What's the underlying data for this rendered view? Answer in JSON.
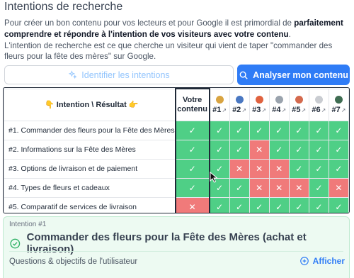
{
  "header": {
    "title": "Intentions de recherche",
    "desc_part1": "Pour créer un bon contenu pour vos lecteurs et pour Google il est primordial de ",
    "desc_bold": "parfaitement comprendre et répondre à l'intention de vos visiteurs avec votre contenu",
    "desc_part2": ".",
    "desc_line2": "L'intention de recherche est ce que cherche un visiteur qui vient de taper \"commander des fleurs pour la fête des mères\" sur Google."
  },
  "actions": {
    "identify_label": "Identifier les intentions",
    "analyze_label": "Analyser mon contenu"
  },
  "matrix": {
    "corner_label": "👇 Intention \\ Résultat 👉",
    "own_label": "Votre contenu",
    "competitors": [
      {
        "num": "#1",
        "icon_color": "#d9a441"
      },
      {
        "num": "#2",
        "icon_color": "#4a78c2"
      },
      {
        "num": "#3",
        "icon_color": "#e0623f"
      },
      {
        "num": "#4",
        "icon_color": "#9aa3ad"
      },
      {
        "num": "#5",
        "icon_color": "#d46a4e"
      },
      {
        "num": "#6",
        "icon_color": "#c9ccd1"
      },
      {
        "num": "#7",
        "icon_color": "#3f6d52"
      }
    ],
    "rows": [
      {
        "label": "#1. Commander des fleurs pour la Fête des Mères",
        "own": "ok",
        "comp": [
          "ok",
          "ok",
          "ok",
          "ok",
          "ok",
          "ok",
          "ok"
        ]
      },
      {
        "label": "#2. Informations sur la Fête des Mères",
        "own": "ok",
        "comp": [
          "ok",
          "ok",
          "ko",
          "ok",
          "ok",
          "ok",
          "ok"
        ]
      },
      {
        "label": "#3. Options de livraison et de paiement",
        "own": "ok",
        "comp": [
          "ok",
          "ko",
          "ko",
          "ko",
          "ok",
          "ok",
          "ok"
        ]
      },
      {
        "label": "#4. Types de fleurs et cadeaux",
        "own": "ok",
        "comp": [
          "ok",
          "ok",
          "ko",
          "ko",
          "ko",
          "ok",
          "ko"
        ]
      },
      {
        "label": "#5. Comparatif de services de livraison",
        "own": "ko",
        "comp": [
          "ok",
          "ok",
          "ok",
          "ok",
          "ok",
          "ok",
          "ok"
        ]
      }
    ],
    "ok_symbol": "✓",
    "ko_symbol": "✕"
  },
  "intent": {
    "small_label": "Intention #1",
    "title": "Commander des fleurs pour la Fête des Mères (achat et livraison)",
    "questions_label": "Questions & objectifs de l'utilisateur",
    "show_label": "Afficher"
  },
  "colors": {
    "ok": "#4fcf86",
    "ko": "#f07a7a",
    "accent": "#2f7cf6"
  }
}
